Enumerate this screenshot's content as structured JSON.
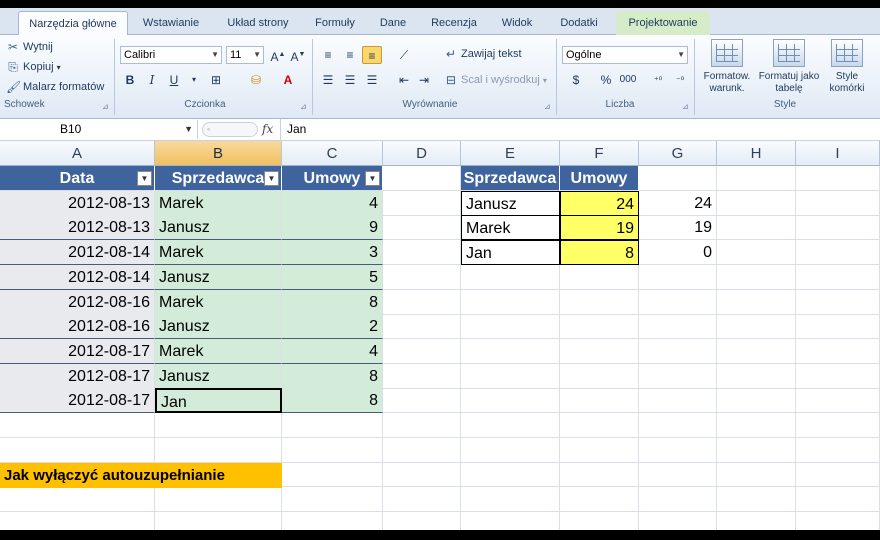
{
  "tabs": [
    {
      "label": "Narzędzia główne"
    },
    {
      "label": "Wstawianie"
    },
    {
      "label": "Układ strony"
    },
    {
      "label": "Formuły"
    },
    {
      "label": "Dane"
    },
    {
      "label": "Recenzja"
    },
    {
      "label": "Widok"
    },
    {
      "label": "Dodatki"
    },
    {
      "label": "Projektowanie"
    }
  ],
  "ribbon": {
    "clipboard": {
      "cut": "Wytnij",
      "copy": "Kopiuj",
      "painter": "Malarz formatów",
      "group": "Schowek"
    },
    "font": {
      "name": "Calibri",
      "size": "11",
      "bold": "B",
      "italic": "I",
      "underline": "U",
      "group": "Czcionka"
    },
    "alignment": {
      "wrap": "Zawijaj tekst",
      "merge": "Scal i wyśrodkuj",
      "group": "Wyrównanie"
    },
    "number": {
      "format": "Ogólne",
      "percent": "%",
      "thousands": "000",
      "group": "Liczba"
    },
    "styles": {
      "conditional": "Formatow. warunk.",
      "table": "Formatuj jako tabelę",
      "cell": "Style komórki",
      "group": "Style"
    }
  },
  "formula_bar": {
    "name_box": "B10",
    "fx": "fx",
    "content": "Jan"
  },
  "columns": [
    "A",
    "B",
    "C",
    "D",
    "E",
    "F",
    "G",
    "H",
    "I"
  ],
  "table1": {
    "headers": [
      "Data",
      "Sprzedawca",
      "Umowy"
    ],
    "rows": [
      [
        "2012-08-13",
        "Marek",
        "4"
      ],
      [
        "2012-08-13",
        "Janusz",
        "9"
      ],
      [
        "2012-08-14",
        "Marek",
        "3"
      ],
      [
        "2012-08-14",
        "Janusz",
        "5"
      ],
      [
        "2012-08-16",
        "Marek",
        "8"
      ],
      [
        "2012-08-16",
        "Janusz",
        "2"
      ],
      [
        "2012-08-17",
        "Marek",
        "4"
      ],
      [
        "2012-08-17",
        "Janusz",
        "8"
      ],
      [
        "2012-08-17",
        "Jan",
        "8"
      ]
    ]
  },
  "table2": {
    "headers": [
      "Sprzedawca",
      "Umowy"
    ],
    "rows": [
      [
        "Janusz",
        "24",
        "24"
      ],
      [
        "Marek",
        "19",
        "19"
      ],
      [
        "Jan",
        "8",
        "0"
      ]
    ]
  },
  "banner": "Jak wyłączyć autouzupełnianie",
  "colors": {
    "header_blue": "#3f639d",
    "band_green": "#d3ecd9",
    "highlight_yellow": "#ffff66",
    "banner_orange": "#ffc000"
  }
}
